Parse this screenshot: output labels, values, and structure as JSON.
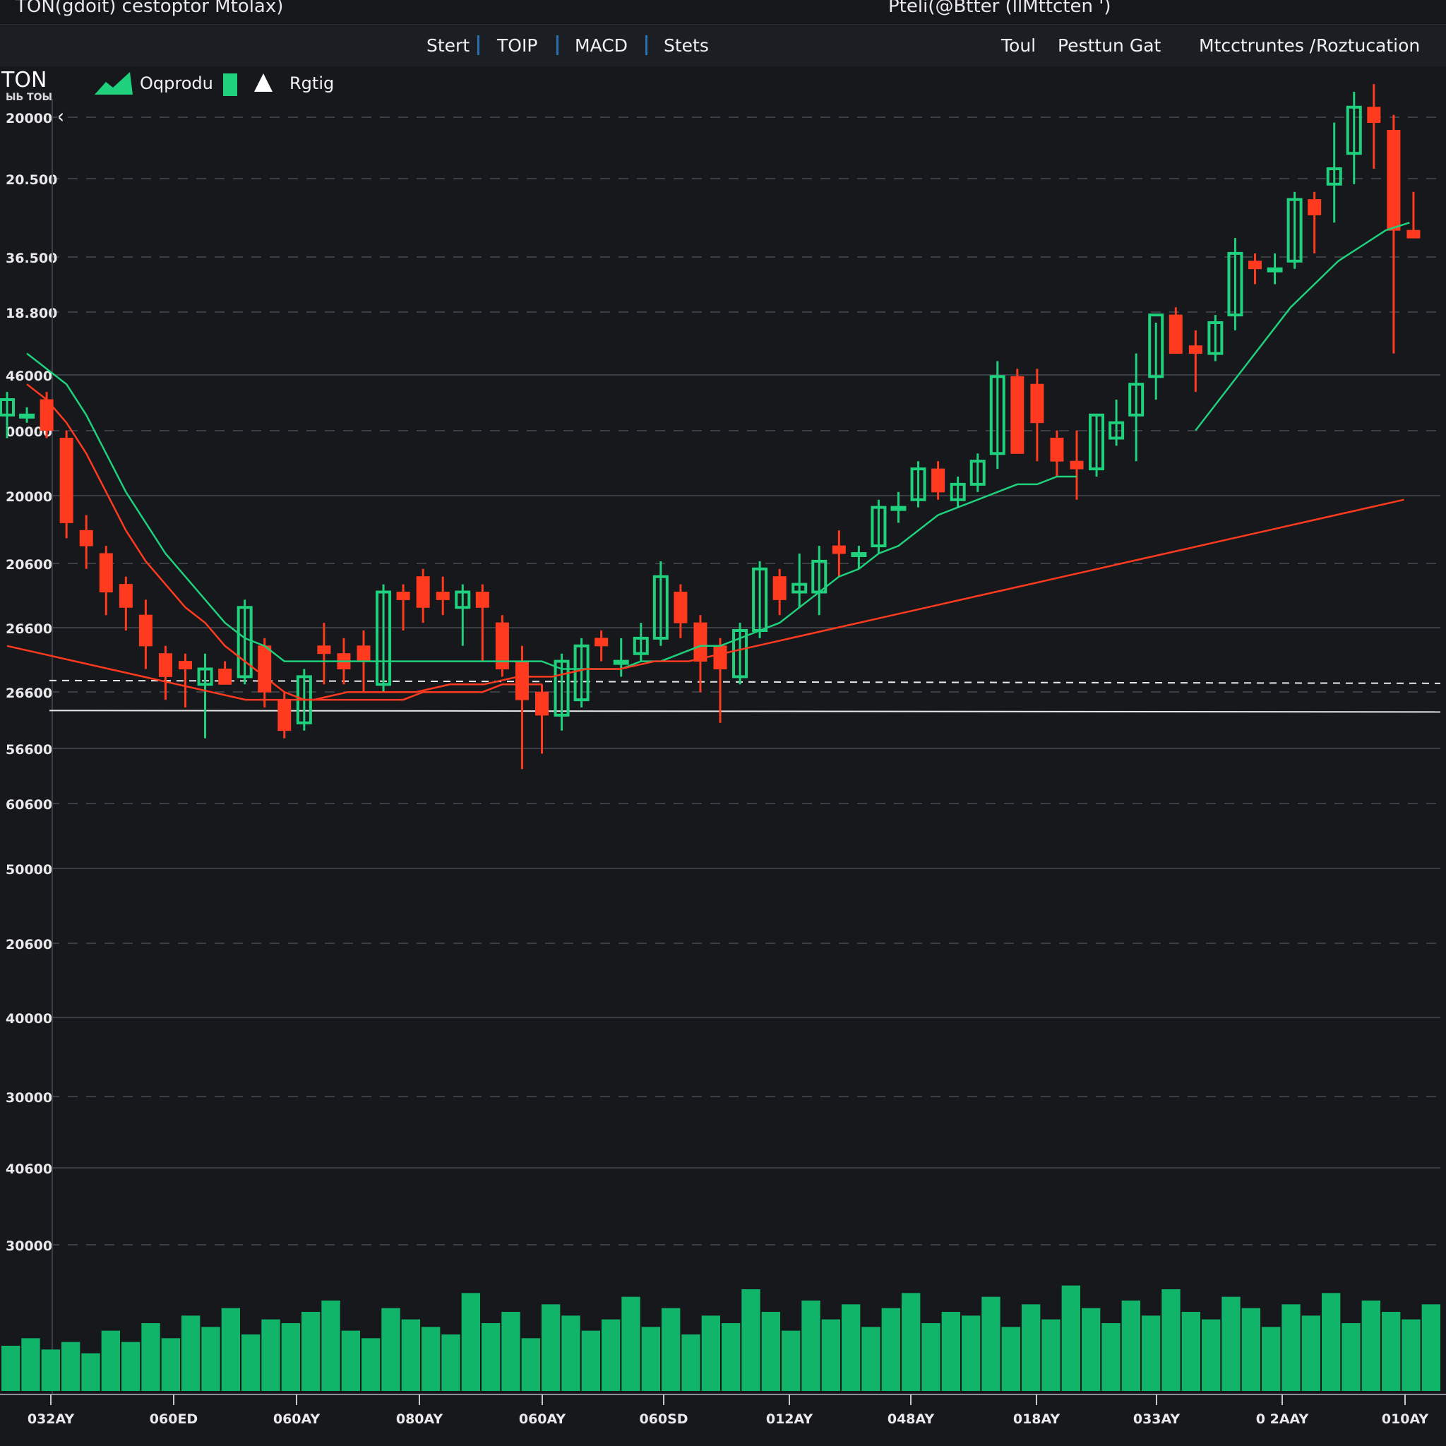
{
  "window": {
    "title_left": "TON(gdoit) cestoptor Mtolax)",
    "title_right": "Pteli(@Btter (llMttcten ')"
  },
  "toolbar": {
    "items": [
      "Stert",
      "TOIP",
      "MACD",
      "Stets",
      "Toul",
      "Pesttun Gat",
      "Mtcctruntes /",
      "Roztucation"
    ]
  },
  "chart_header": {
    "symbol": "TON",
    "symbol_sub": "ЫЬ ТОЫ",
    "legend": [
      {
        "label": "Oqprodu",
        "icon": "area-chart-icon"
      },
      {
        "label": "",
        "icon": "green-bar-icon"
      },
      {
        "label": "Rgtig",
        "icon": "triangle-up-icon"
      }
    ]
  },
  "colors": {
    "background": "#16181c",
    "up": "#1fd07c",
    "down": "#ff3a1f",
    "grid": "#3a3e45",
    "volume": "#10b56a"
  },
  "chart_data": {
    "type": "candlestick",
    "title": "",
    "y_tick_labels": [
      "20000",
      "20.500",
      "36.500",
      "18.800",
      "46000",
      "00000",
      "20000",
      "20600",
      "26600",
      "26600",
      "56600",
      "60600",
      "50000",
      "20600",
      "40000",
      "30000",
      "40600",
      "30000"
    ],
    "x_tick_labels": [
      "032AY",
      "060ED",
      "060AY",
      "080AY",
      "060AY",
      "060SD",
      "012AY",
      "048AY",
      "018AY",
      "033AY",
      "0 2AAY",
      "010AY"
    ],
    "price_range": [
      0,
      100
    ],
    "grid": true,
    "candles": [
      {
        "o": 58,
        "h": 61,
        "l": 55,
        "c": 60
      },
      {
        "o": 58,
        "h": 59,
        "l": 57,
        "c": 58
      },
      {
        "o": 60,
        "h": 61,
        "l": 55,
        "c": 56
      },
      {
        "o": 55,
        "h": 56,
        "l": 42,
        "c": 44
      },
      {
        "o": 43,
        "h": 45,
        "l": 38,
        "c": 41
      },
      {
        "o": 40,
        "h": 41,
        "l": 32,
        "c": 35
      },
      {
        "o": 36,
        "h": 37,
        "l": 30,
        "c": 33
      },
      {
        "o": 32,
        "h": 34,
        "l": 25,
        "c": 28
      },
      {
        "o": 27,
        "h": 28,
        "l": 21,
        "c": 24
      },
      {
        "o": 26,
        "h": 27,
        "l": 20,
        "c": 25
      },
      {
        "o": 23,
        "h": 27,
        "l": 16,
        "c": 25
      },
      {
        "o": 25,
        "h": 26,
        "l": 23,
        "c": 23
      },
      {
        "o": 24,
        "h": 34,
        "l": 23,
        "c": 33
      },
      {
        "o": 28,
        "h": 29,
        "l": 20,
        "c": 22
      },
      {
        "o": 21,
        "h": 22,
        "l": 16,
        "c": 17
      },
      {
        "o": 18,
        "h": 25,
        "l": 17,
        "c": 24
      },
      {
        "o": 28,
        "h": 31,
        "l": 23,
        "c": 27
      },
      {
        "o": 27,
        "h": 29,
        "l": 23,
        "c": 25
      },
      {
        "o": 28,
        "h": 30,
        "l": 22,
        "c": 26
      },
      {
        "o": 23,
        "h": 36,
        "l": 22,
        "c": 35
      },
      {
        "o": 35,
        "h": 36,
        "l": 30,
        "c": 34
      },
      {
        "o": 37,
        "h": 38,
        "l": 31,
        "c": 33
      },
      {
        "o": 35,
        "h": 37,
        "l": 32,
        "c": 34
      },
      {
        "o": 33,
        "h": 36,
        "l": 28,
        "c": 35
      },
      {
        "o": 35,
        "h": 36,
        "l": 26,
        "c": 33
      },
      {
        "o": 31,
        "h": 32,
        "l": 24,
        "c": 25
      },
      {
        "o": 26,
        "h": 28,
        "l": 12,
        "c": 21
      },
      {
        "o": 22,
        "h": 23,
        "l": 14,
        "c": 19
      },
      {
        "o": 19,
        "h": 27,
        "l": 17,
        "c": 26
      },
      {
        "o": 21,
        "h": 29,
        "l": 20,
        "c": 28
      },
      {
        "o": 29,
        "h": 30,
        "l": 26,
        "c": 28
      },
      {
        "o": 26,
        "h": 29,
        "l": 24,
        "c": 26
      },
      {
        "o": 27,
        "h": 31,
        "l": 26,
        "c": 29
      },
      {
        "o": 29,
        "h": 39,
        "l": 28,
        "c": 37
      },
      {
        "o": 35,
        "h": 36,
        "l": 29,
        "c": 31
      },
      {
        "o": 31,
        "h": 32,
        "l": 22,
        "c": 26
      },
      {
        "o": 28,
        "h": 29,
        "l": 18,
        "c": 25
      },
      {
        "o": 24,
        "h": 31,
        "l": 23,
        "c": 30
      },
      {
        "o": 30,
        "h": 39,
        "l": 29,
        "c": 38
      },
      {
        "o": 37,
        "h": 38,
        "l": 32,
        "c": 34
      },
      {
        "o": 35,
        "h": 40,
        "l": 33,
        "c": 36
      },
      {
        "o": 35,
        "h": 41,
        "l": 32,
        "c": 39
      },
      {
        "o": 41,
        "h": 43,
        "l": 37,
        "c": 40
      },
      {
        "o": 40,
        "h": 41,
        "l": 38,
        "c": 40
      },
      {
        "o": 41,
        "h": 47,
        "l": 40,
        "c": 46
      },
      {
        "o": 46,
        "h": 48,
        "l": 44,
        "c": 46
      },
      {
        "o": 47,
        "h": 52,
        "l": 46,
        "c": 51
      },
      {
        "o": 51,
        "h": 52,
        "l": 47,
        "c": 48
      },
      {
        "o": 47,
        "h": 50,
        "l": 46,
        "c": 49
      },
      {
        "o": 49,
        "h": 53,
        "l": 48,
        "c": 52
      },
      {
        "o": 53,
        "h": 65,
        "l": 51,
        "c": 63
      },
      {
        "o": 63,
        "h": 64,
        "l": 53,
        "c": 53
      },
      {
        "o": 62,
        "h": 64,
        "l": 52,
        "c": 57
      },
      {
        "o": 55,
        "h": 56,
        "l": 50,
        "c": 52
      },
      {
        "o": 52,
        "h": 56,
        "l": 47,
        "c": 51
      },
      {
        "o": 51,
        "h": 58,
        "l": 50,
        "c": 58
      },
      {
        "o": 55,
        "h": 60,
        "l": 54,
        "c": 57
      },
      {
        "o": 58,
        "h": 66,
        "l": 52,
        "c": 62
      },
      {
        "o": 63,
        "h": 70,
        "l": 60,
        "c": 71
      },
      {
        "o": 71,
        "h": 72,
        "l": 66,
        "c": 66
      },
      {
        "o": 67,
        "h": 69,
        "l": 61,
        "c": 66
      },
      {
        "o": 66,
        "h": 71,
        "l": 65,
        "c": 70
      },
      {
        "o": 71,
        "h": 81,
        "l": 69,
        "c": 79
      },
      {
        "o": 78,
        "h": 79,
        "l": 75,
        "c": 77
      },
      {
        "o": 77,
        "h": 79,
        "l": 75,
        "c": 77
      },
      {
        "o": 78,
        "h": 87,
        "l": 77,
        "c": 86
      },
      {
        "o": 86,
        "h": 87,
        "l": 79,
        "c": 84
      },
      {
        "o": 88,
        "h": 96,
        "l": 83,
        "c": 90
      },
      {
        "o": 92,
        "h": 100,
        "l": 88,
        "c": 98
      },
      {
        "o": 98,
        "h": 101,
        "l": 90,
        "c": 96
      },
      {
        "o": 95,
        "h": 97,
        "l": 66,
        "c": 82
      },
      {
        "o": 82,
        "h": 87,
        "l": 81,
        "c": 81
      }
    ],
    "ma_fast_green": [
      66,
      64,
      62,
      58,
      53,
      48,
      44,
      40,
      37,
      34,
      31,
      29,
      28,
      26,
      26,
      26,
      26,
      26,
      26,
      26,
      26,
      26,
      26,
      26,
      26,
      26,
      26,
      25,
      25,
      25,
      25,
      26,
      26,
      27,
      28,
      28,
      29,
      30,
      31,
      33,
      35,
      37,
      38,
      40,
      41,
      43,
      45,
      46,
      47,
      48,
      49,
      49,
      50,
      50
    ],
    "ma_slow_red_1": [
      62,
      60,
      57,
      53,
      48,
      43,
      39,
      36,
      33,
      31,
      28,
      26,
      24,
      22,
      21,
      21,
      21,
      21,
      21,
      21,
      22,
      22,
      22,
      22,
      23,
      23,
      23
    ],
    "ma_slow_red_2": [
      28,
      27,
      26,
      25,
      24,
      23,
      22,
      21,
      21,
      21,
      22,
      22,
      22,
      23,
      23,
      24,
      24,
      25,
      25,
      26,
      26,
      27,
      28,
      29,
      30,
      31,
      32,
      33,
      34,
      35,
      36,
      37,
      38,
      39,
      40,
      41,
      42,
      43,
      44,
      45,
      46,
      47
    ],
    "ma_green_2": [
      56,
      60,
      64,
      68,
      72,
      75,
      78,
      80,
      82,
      83
    ],
    "support_dashed": 23.5,
    "support_solid": 19.6,
    "volume": [
      12,
      14,
      11,
      13,
      10,
      16,
      13,
      18,
      14,
      20,
      17,
      22,
      15,
      19,
      18,
      21,
      24,
      16,
      14,
      22,
      19,
      17,
      15,
      26,
      18,
      21,
      14,
      23,
      20,
      16,
      19,
      25,
      17,
      22,
      15,
      20,
      18,
      27,
      21,
      16,
      24,
      19,
      23,
      17,
      22,
      26,
      18,
      21,
      20,
      25,
      17,
      23,
      19,
      28,
      22,
      18,
      24,
      20,
      27,
      21,
      19,
      25,
      22,
      17,
      23,
      20,
      26,
      18,
      24,
      21,
      19,
      23
    ]
  }
}
